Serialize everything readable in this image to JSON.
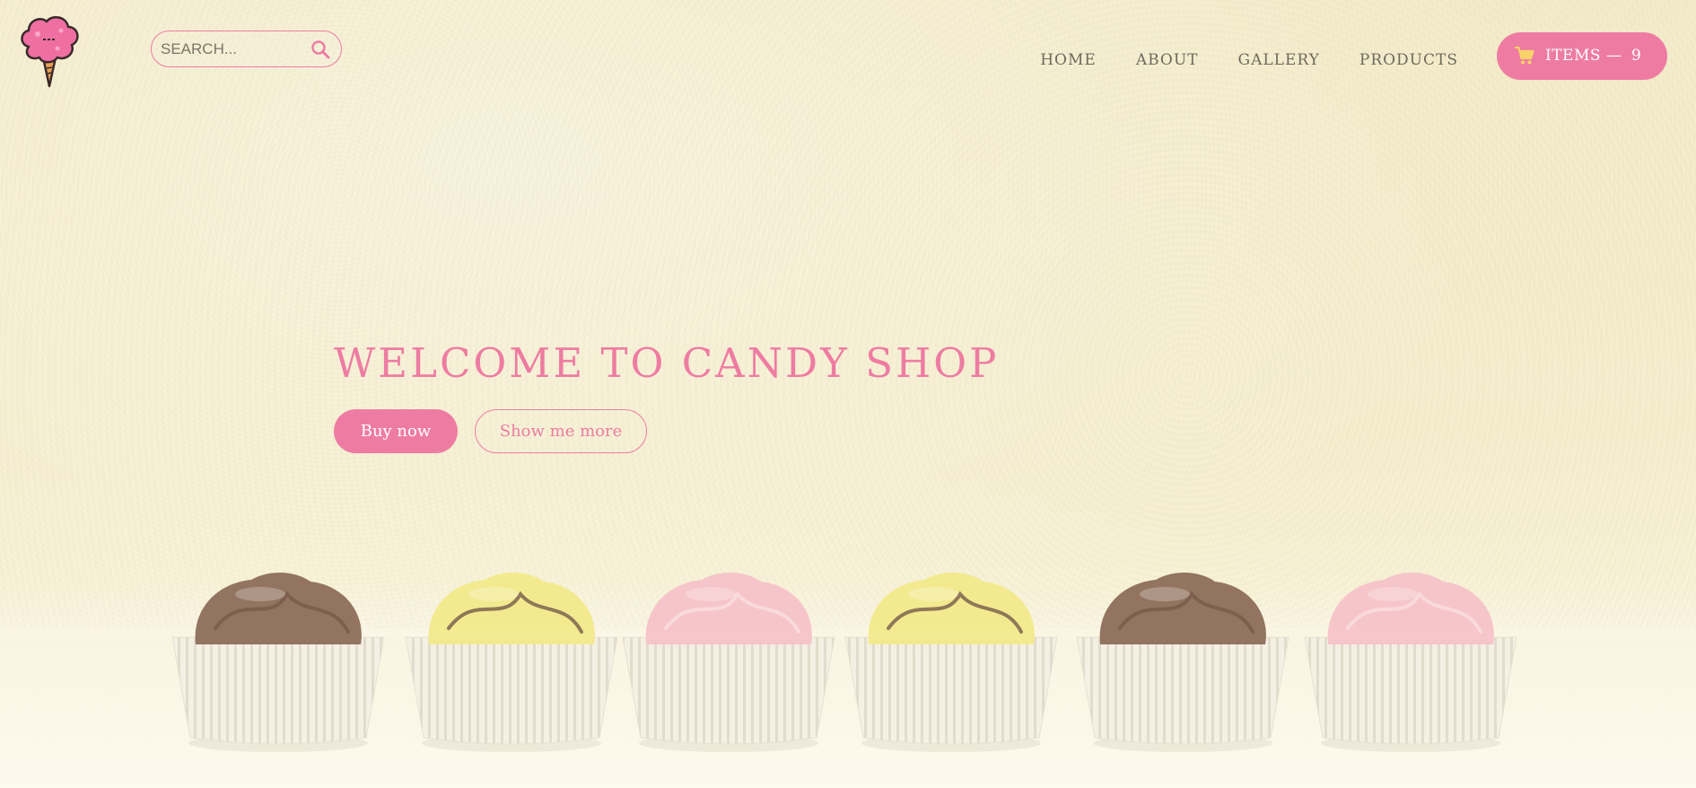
{
  "header": {
    "logo_icon": "cotton-candy-logo",
    "search": {
      "placeholder": "SEARCH...",
      "value": "",
      "icon": "search-icon"
    },
    "nav": [
      {
        "label": "HOME"
      },
      {
        "label": "ABOUT"
      },
      {
        "label": "GALLERY"
      },
      {
        "label": "PRODUCTS"
      }
    ],
    "cart": {
      "icon": "cart-icon",
      "label": "ITEMS —",
      "count": "9"
    }
  },
  "hero": {
    "title": "WELCOME TO CANDY SHOP",
    "buy_button": "Buy now",
    "more_button": "Show me more",
    "candies": [
      "chocolate",
      "lemon",
      "strawberry",
      "lemon",
      "chocolate",
      "strawberry"
    ]
  },
  "colors": {
    "accent": "#ee7ca2",
    "background": "#f6efcf",
    "nav_text": "#6e6a5c",
    "chocolate": "#8a6a56",
    "lemon": "#f3ea8a",
    "strawberry": "#f6c2c9"
  }
}
